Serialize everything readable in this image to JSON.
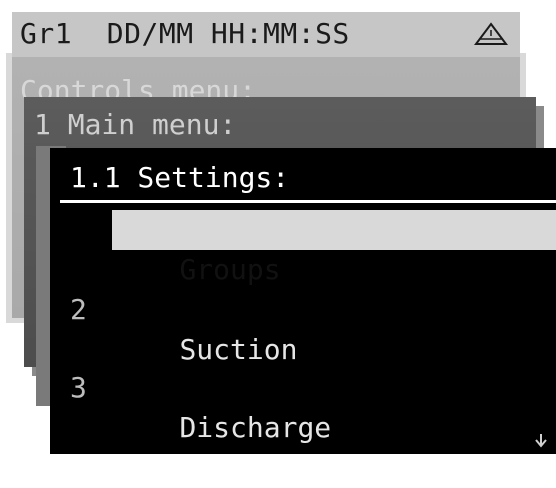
{
  "status_bar": {
    "text": "Gr1  DD/MM HH:MM:SS",
    "alarm_icon": "warning-triangle-icon"
  },
  "controls_menu": {
    "title": "Controls menu:"
  },
  "main_menu": {
    "title": "1 Main menu:"
  },
  "settings_menu": {
    "title": "1.1 Settings:",
    "items": [
      {
        "number": "",
        "label": "Groups",
        "selected": true
      },
      {
        "number": "2",
        "label": "Suction",
        "selected": false
      },
      {
        "number": "3",
        "label": "Discharge",
        "selected": false
      }
    ],
    "scroll_icon": "scroll-down-arrow-icon"
  },
  "colors": {
    "status_bar_bg": "#c6c6c6",
    "front_window_bg": "#000000",
    "selection_bg": "#d9d9d9"
  }
}
